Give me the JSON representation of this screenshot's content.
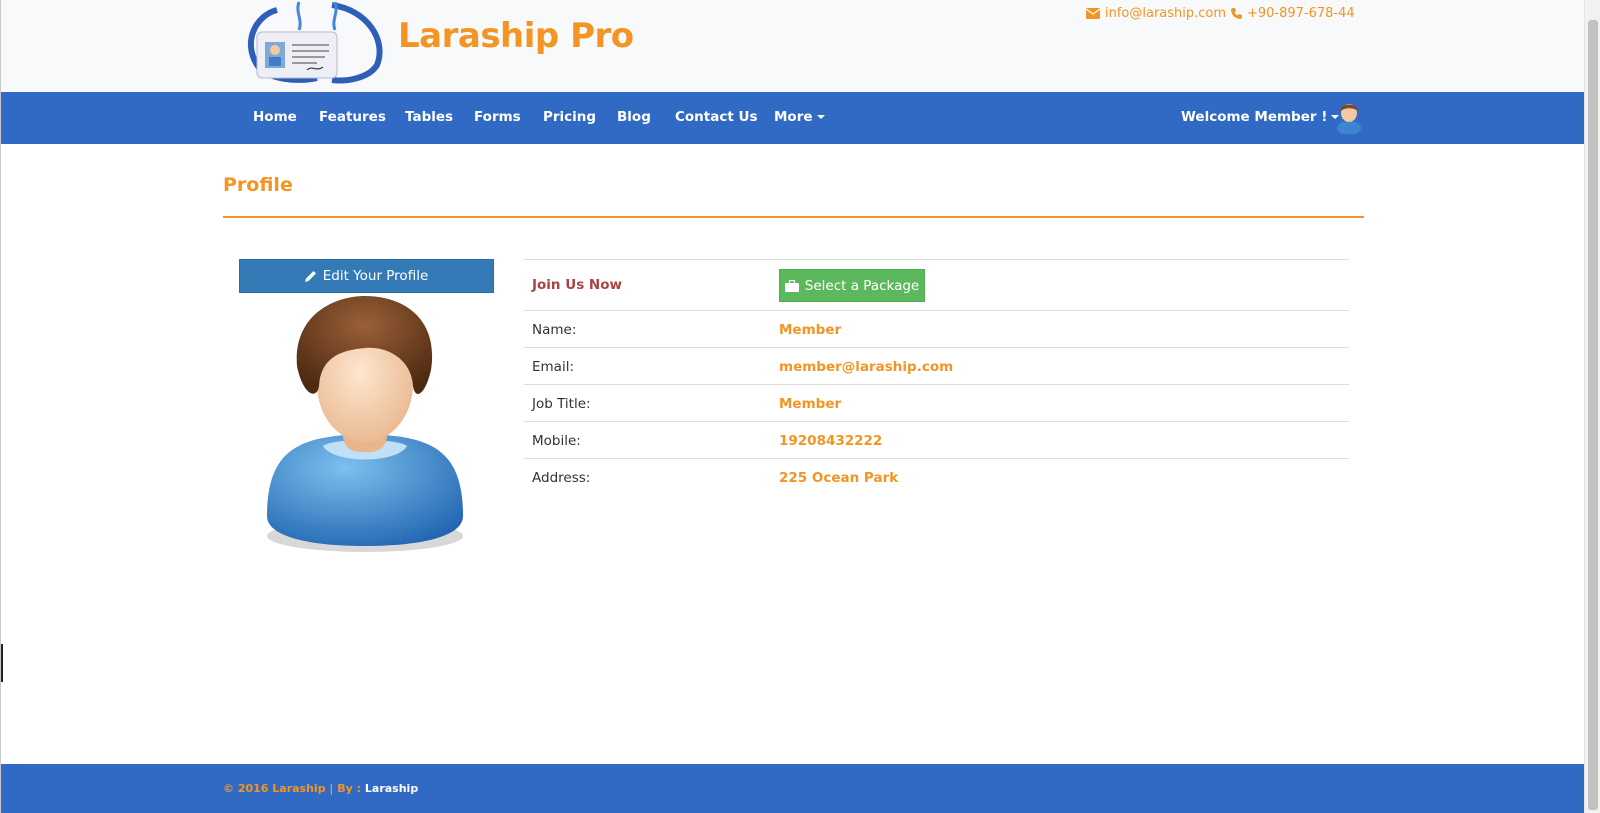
{
  "header": {
    "brand": "Laraship Pro",
    "email": "info@laraship.com",
    "phone": "+90-897-678-44"
  },
  "nav": {
    "items": [
      "Home",
      "Features",
      "Tables",
      "Forms",
      "Pricing",
      "Blog",
      "Contact Us",
      "More"
    ],
    "welcome": "Welcome Member !"
  },
  "page": {
    "title": "Profile",
    "edit_button": "Edit Your Profile"
  },
  "profile": {
    "join_label": "Join Us Now",
    "package_button": "Select a Package",
    "fields": [
      {
        "label": "Name:",
        "value": "Member"
      },
      {
        "label": "Email:",
        "value": "member@laraship.com"
      },
      {
        "label": "Job Title:",
        "value": "Member"
      },
      {
        "label": "Mobile:",
        "value": "19208432222"
      },
      {
        "label": "Address:",
        "value": "225 Ocean Park"
      }
    ]
  },
  "footer": {
    "text": "© 2016 Laraship | By :",
    "author": "Laraship"
  },
  "colors": {
    "brand_orange": "#f39522",
    "nav_blue": "#316ac4",
    "button_blue": "#337ab7",
    "button_green": "#5cb85c",
    "join_red": "#a94442"
  }
}
